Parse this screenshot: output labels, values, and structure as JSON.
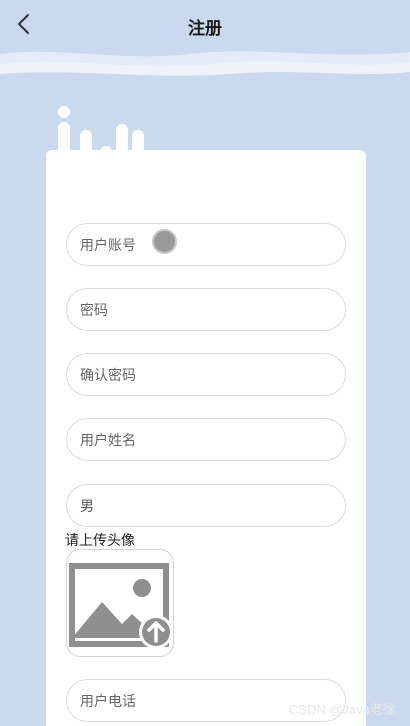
{
  "nav": {
    "title": "注册"
  },
  "form": {
    "account_placeholder": "用户账号",
    "password_placeholder": "密码",
    "confirm_placeholder": "确认密码",
    "name_placeholder": "用户姓名",
    "gender_value": "男",
    "upload_label": "请上传头像",
    "phone_placeholder": "用户电话"
  },
  "watermark": "CSDN @Java老徐",
  "colors": {
    "background": "#cbd9ee",
    "card": "#ffffff",
    "border": "#dcdcdc"
  }
}
